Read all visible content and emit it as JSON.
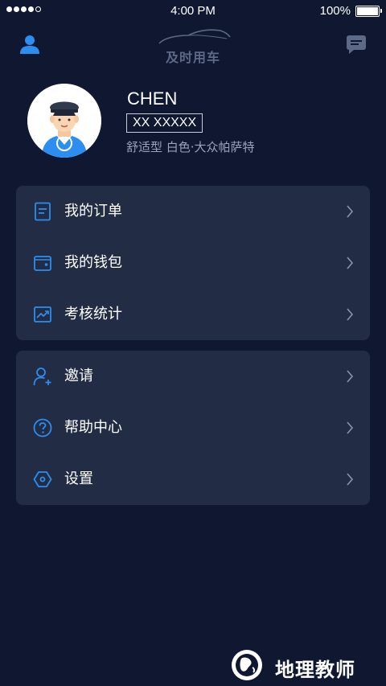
{
  "status_bar": {
    "time": "4:00 PM",
    "battery": "100%"
  },
  "header": {
    "logo_text": "及时用车"
  },
  "profile": {
    "name": "CHEN",
    "plate": "XX XXXXX",
    "car_info": "舒适型 白色·大众帕萨特"
  },
  "menu_group1": [
    {
      "label": "我的订单",
      "icon": "order-list-icon"
    },
    {
      "label": "我的钱包",
      "icon": "wallet-icon"
    },
    {
      "label": "考核统计",
      "icon": "statistics-chart-icon"
    }
  ],
  "menu_group2": [
    {
      "label": "邀请",
      "icon": "invite-user-icon"
    },
    {
      "label": "帮助中心",
      "icon": "help-icon"
    },
    {
      "label": "设置",
      "icon": "settings-icon"
    }
  ],
  "watermark": {
    "text": "地理教师"
  },
  "colors": {
    "background": "#0f1830",
    "card": "#232c45",
    "accent": "#2b8ef0",
    "muted_text": "#9aa3b8"
  }
}
